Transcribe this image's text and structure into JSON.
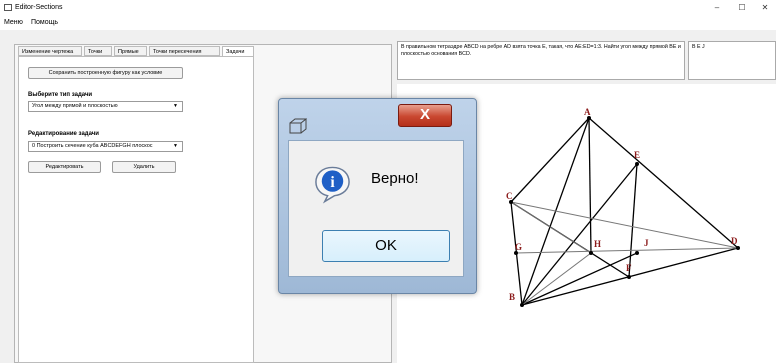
{
  "window": {
    "title": "Editor-Sections",
    "controls": {
      "minimize": "–",
      "maximize": "☐",
      "close": "✕"
    }
  },
  "menu": {
    "items": [
      "Меню",
      "Помощь"
    ]
  },
  "tabs": [
    "Изменение чертежа",
    "Точки",
    "Прямые",
    "Точки пересечения",
    "Задачи"
  ],
  "tasks_panel": {
    "save_button": "Сохранить построенную фигуру как условие",
    "task_type_label": "Выберите тип задачи",
    "task_type_value": "Угол между прямой и плоскостью",
    "edit_label": "Редактирование задачи",
    "edit_value": "0  Построить сечение куба ABCDEFGH плоскос",
    "edit_button": "Редактировать",
    "delete_button": "Удалить"
  },
  "task_text": "В правильном тетраэдре ABCD на ребре AD взята точка E, такая, что AE:ED=1:3. Найти угол между прямой BE и плоскостью основания BCD.",
  "answer_text": "B E J",
  "dialog": {
    "close_glyph": "X",
    "message": "Верно!",
    "ok_label": "OK",
    "info_glyph": "i"
  },
  "figure": {
    "point_labels": [
      "A",
      "E",
      "C",
      "G",
      "H",
      "J",
      "D",
      "F",
      "B"
    ],
    "colors": {
      "edges": "#000000",
      "labels": "#8b1a1a",
      "hidden": "#888888"
    }
  }
}
